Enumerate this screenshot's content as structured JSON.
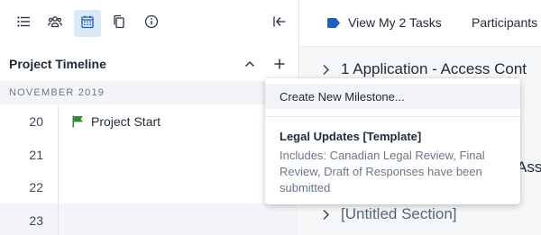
{
  "toolbar": {
    "icons": [
      "list-icon",
      "people-icon",
      "calendar-icon",
      "copy-icon",
      "info-icon",
      "collapse-left-icon"
    ],
    "active": "calendar-icon",
    "accent_color": "#dbe8f7"
  },
  "timeline": {
    "title": "Project Timeline",
    "month": "NOVEMBER 2019",
    "days": [
      {
        "day": "20",
        "milestone": "Project Start"
      },
      {
        "day": "21",
        "milestone": ""
      },
      {
        "day": "22",
        "milestone": ""
      },
      {
        "day": "23",
        "milestone": ""
      }
    ],
    "flag_color": "#2e8b3a"
  },
  "right": {
    "view_tasks": "View My 2 Tasks",
    "participants": "Participants",
    "rows": [
      {
        "label": "1 Application - Access Cont"
      },
      {
        "label": "Ass"
      },
      {
        "label": "[Untitled Section]"
      }
    ],
    "tag_color": "#1f5fb5"
  },
  "menu": {
    "create_label": "Create New Milestone...",
    "template_title": "Legal Updates [Template]",
    "template_desc": "Includes: Canadian Legal Review, Final Review, Draft of Responses have been submitted"
  }
}
